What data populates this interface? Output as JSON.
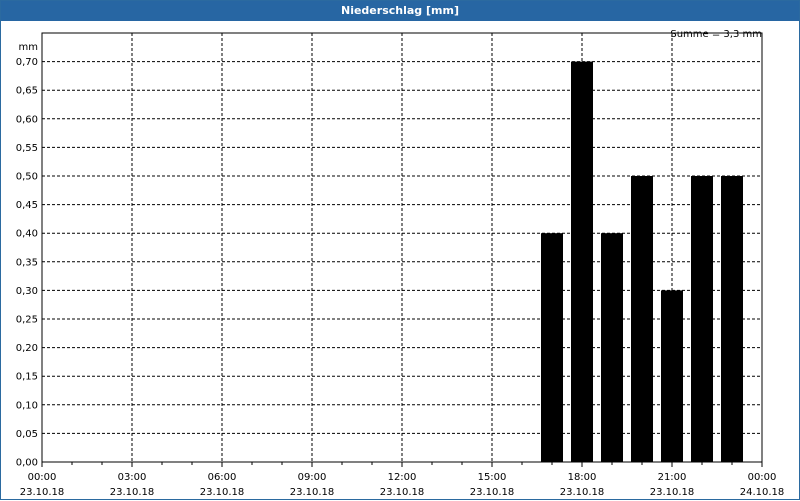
{
  "window": {
    "title": "Niederschlag [mm]"
  },
  "chart_data": {
    "type": "bar",
    "title": "Niederschlag [mm]",
    "ylabel": "mm",
    "annotation": "Summe = 3,3 mm",
    "ylim": [
      0,
      0.75
    ],
    "yticks": [
      "0,00",
      "0,05",
      "0,10",
      "0,15",
      "0,20",
      "0,25",
      "0,30",
      "0,35",
      "0,40",
      "0,45",
      "0,50",
      "0,55",
      "0,60",
      "0,65",
      "0,70"
    ],
    "xlim_hours": [
      0,
      24
    ],
    "xticks": [
      {
        "time": "00:00",
        "date": "23.10.18"
      },
      {
        "time": "03:00",
        "date": "23.10.18"
      },
      {
        "time": "06:00",
        "date": "23.10.18"
      },
      {
        "time": "09:00",
        "date": "23.10.18"
      },
      {
        "time": "12:00",
        "date": "23.10.18"
      },
      {
        "time": "15:00",
        "date": "23.10.18"
      },
      {
        "time": "18:00",
        "date": "23.10.18"
      },
      {
        "time": "21:00",
        "date": "23.10.18"
      },
      {
        "time": "00:00",
        "date": "24.10.18"
      }
    ],
    "categories": [
      "17:00",
      "18:00",
      "19:00",
      "20:00",
      "21:00",
      "22:00",
      "23:00"
    ],
    "bar_hours": [
      17,
      18,
      19,
      20,
      21,
      22,
      23
    ],
    "values": [
      0.4,
      0.7,
      0.4,
      0.5,
      0.3,
      0.5,
      0.5
    ],
    "bar_color": "#000000",
    "grid": true
  }
}
